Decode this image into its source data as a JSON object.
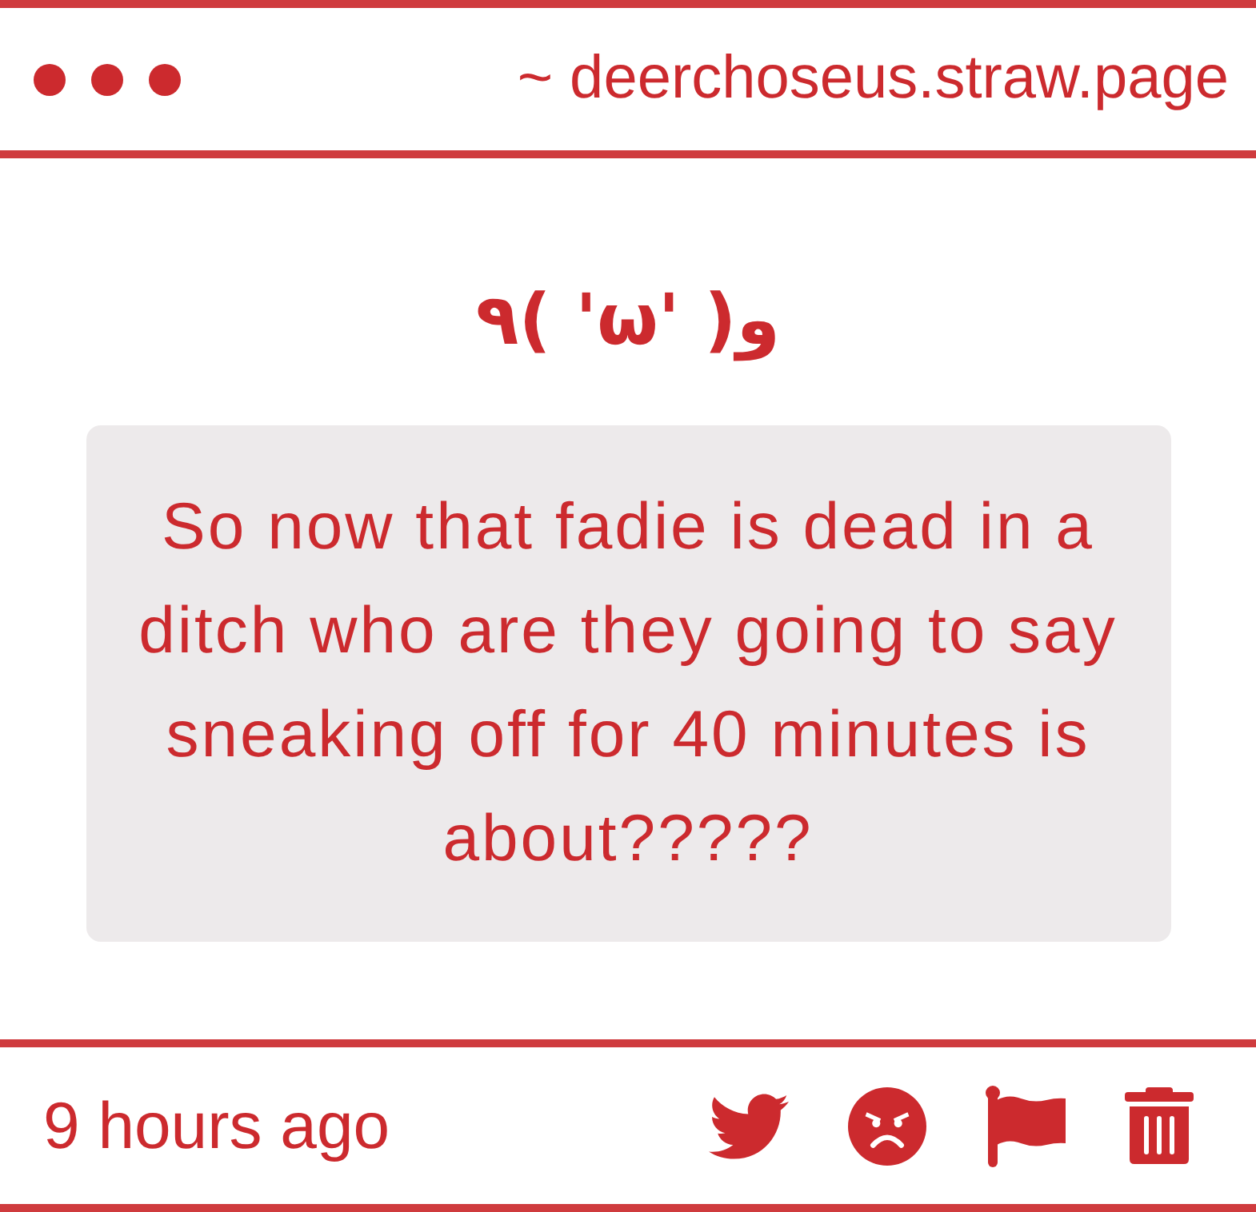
{
  "header": {
    "url": "~ deerchoseus.straw.page"
  },
  "kaomoji": "٩( 'ω' )و",
  "message": "So now that fadie is dead in a ditch who are they going to say sneaking off for 40 minutes is about?????",
  "footer": {
    "time": "9 hours ago"
  }
}
